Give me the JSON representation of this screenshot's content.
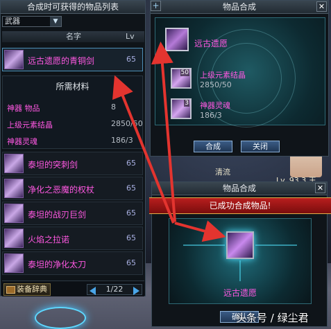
{
  "left_panel": {
    "title": "合成时可获得的物品列表",
    "filter_value": "武器",
    "columns": {
      "name": "名字",
      "lv": "Lv"
    },
    "selected_item": {
      "name": "远古遗愿的青铜剑",
      "lv": "65"
    },
    "materials": {
      "title": "所需材料",
      "rows": [
        {
          "name": "神器 物品",
          "value": "8"
        },
        {
          "name": "上级元素结晶",
          "value": "2850/50"
        },
        {
          "name": "神器灵魂",
          "value": "186/3"
        }
      ]
    },
    "items": [
      {
        "name": "泰坦的突刺剑",
        "lv": "65"
      },
      {
        "name": "净化之恶魔的权杖",
        "lv": "65"
      },
      {
        "name": "泰坦的战刃巨剑",
        "lv": "65"
      },
      {
        "name": "火焰之拉诺",
        "lv": "65"
      },
      {
        "name": "泰坦的净化太刀",
        "lv": "65"
      }
    ],
    "dictionary_button": "装备辞典",
    "page": "1/22"
  },
  "synthesis_window": {
    "title": "物品合成",
    "plus_label": "+",
    "result_name": "远古遗愿",
    "inputs": [
      {
        "name": "上级元素结晶",
        "qty": "2850/50",
        "badge": "50"
      },
      {
        "name": "神器灵魂",
        "qty": "186/3",
        "badge": "3"
      }
    ],
    "confirm_button": "合成",
    "close_button": "关闭"
  },
  "success_window": {
    "title": "物品合成",
    "banner": "已成功合成物品!",
    "item_name": "远古遗愿",
    "confirm_button": "确认"
  },
  "background_text": {
    "t1": "清流",
    "t2": "Lv. 93.3 王"
  },
  "watermark": "头条号 / 绿尘君",
  "colors": {
    "item_name": "#ff58e2",
    "arrow": "#e3342f",
    "banner": "#b81e1e"
  }
}
